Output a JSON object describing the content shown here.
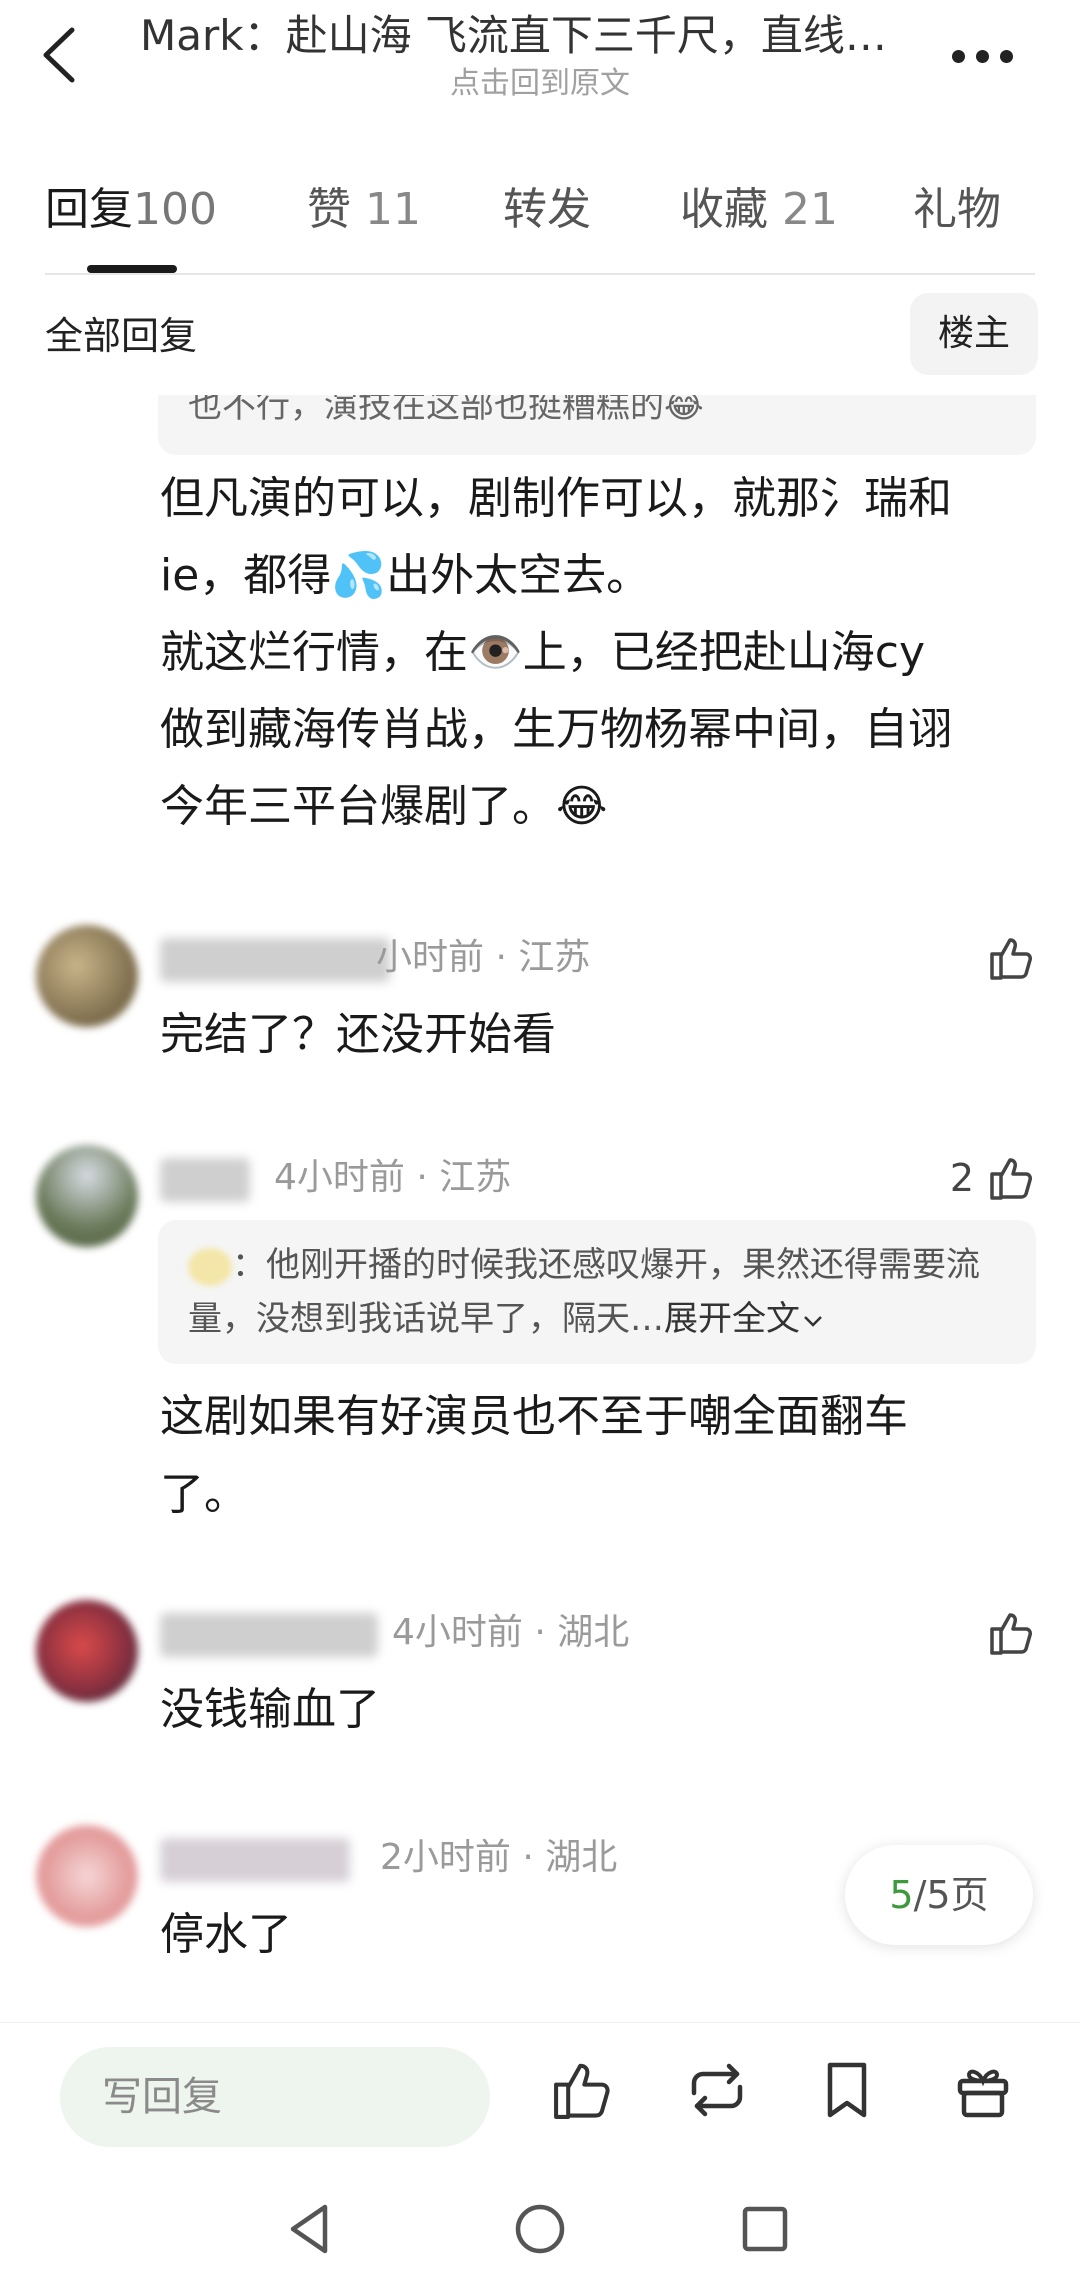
{
  "header": {
    "title": "Mark：赴山海  飞流直下三千尺，直线…",
    "subtitle": "点击回到原文"
  },
  "tabs": [
    {
      "label": "回复",
      "count": "100"
    },
    {
      "label": "赞",
      "count": "11"
    },
    {
      "label": "转发",
      "count": ""
    },
    {
      "label": "收藏",
      "count": "21"
    },
    {
      "label": "礼物",
      "count": ""
    }
  ],
  "filter": {
    "label": "全部回复",
    "owner_button": "楼主"
  },
  "top_comment": {
    "quote_partial": "也不行，演技在这部也挺糟糕的😂",
    "lines": [
      "但凡演的可以，剧制作可以，就那氵瑞和",
      "ie，都得💦出外太空去。",
      "就这烂行情，在👁️上，已经把赴山海cy",
      "做到藏海传肖战，生万物杨幂中间，自诩",
      "今年三平台爆剧了。😂"
    ]
  },
  "comments": [
    {
      "meta": "小时前 · 江苏",
      "text": "完结了？还没开始看",
      "likes": ""
    },
    {
      "meta": "4小时前 · 江苏",
      "likes": "2",
      "quote": "：他刚开播的时候我还感叹爆开，果然还得需要流量，没想到我话说早了，隔天…",
      "expand": "展开全文",
      "text_lines": [
        "这剧如果有好演员也不至于嘲全面翻车",
        "了。"
      ]
    },
    {
      "meta": "4小时前 · 湖北",
      "text": "没钱输血了",
      "likes": ""
    },
    {
      "meta": "2小时前 · 湖北",
      "text": "停水了",
      "likes": ""
    }
  ],
  "pagination": {
    "current": "5",
    "total": "/5页"
  },
  "bottom_bar": {
    "reply_placeholder": "写回复"
  },
  "colors": {
    "accent_green": "#3c9a3c",
    "quote_bg": "#f5f5f5",
    "input_bg": "#eef4ee"
  }
}
